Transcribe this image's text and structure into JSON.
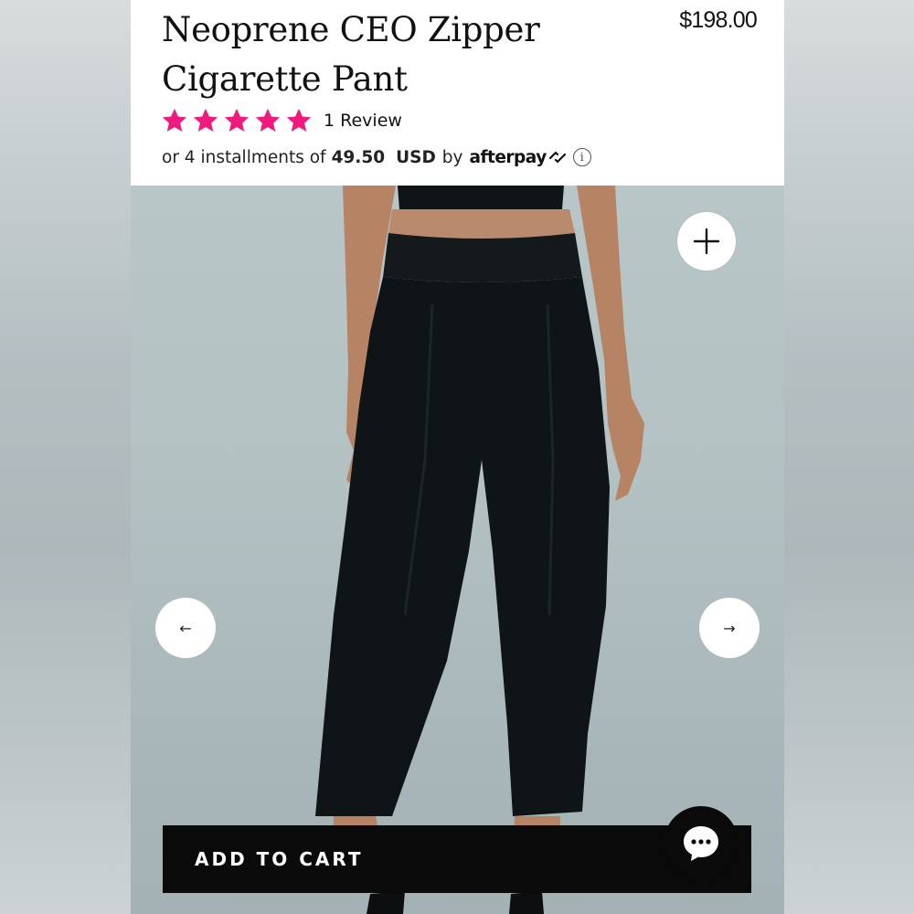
{
  "product": {
    "title": "Neoprene CEO Zipper Cigarette Pant",
    "price": "$198.00",
    "rating": 5,
    "rating_max": 5,
    "review_count_label": "1 Review"
  },
  "afterpay": {
    "prefix": "or 4 installments of",
    "amount": "49.50",
    "currency": "USD",
    "by": "by",
    "brand": "afterpay",
    "info_icon": "info-icon"
  },
  "gallery": {
    "zoom_icon": "plus-icon",
    "prev_arrow": "←",
    "next_arrow": "→"
  },
  "cart": {
    "add_to_cart_label": "ADD TO CART"
  },
  "chat": {
    "icon": "chat-bubble-icon"
  },
  "colors": {
    "star": "#f0197d",
    "button": "#0a0a0a",
    "photo_bg": "#b3c1c3"
  }
}
